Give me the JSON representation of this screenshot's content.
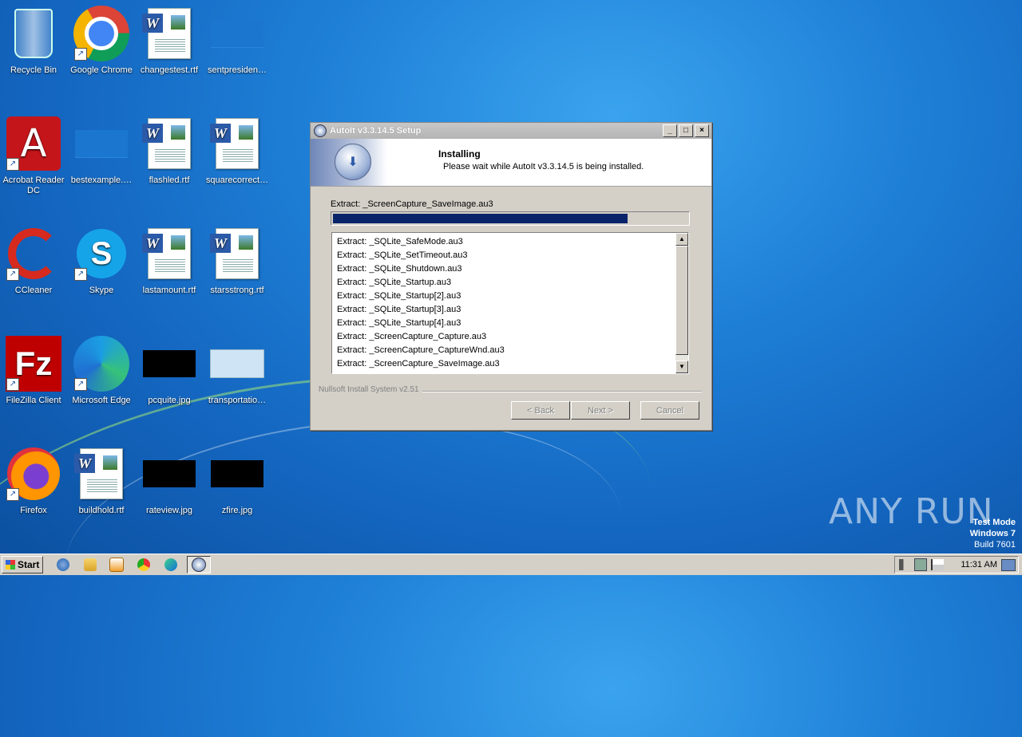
{
  "desktop": {
    "icons": [
      {
        "label": "Recycle Bin",
        "kind": "recycle-bin"
      },
      {
        "label": "Google Chrome",
        "kind": "chrome"
      },
      {
        "label": "changestest.rtf",
        "kind": "word-doc"
      },
      {
        "label": "sentpresiden…",
        "kind": "blank-thumb"
      },
      {
        "label": "Acrobat Reader DC",
        "kind": "acrobat"
      },
      {
        "label": "bestexample.…",
        "kind": "blank-thumb"
      },
      {
        "label": "flashled.rtf",
        "kind": "word-doc"
      },
      {
        "label": "squarecorrect…",
        "kind": "word-doc"
      },
      {
        "label": "CCleaner",
        "kind": "ccleaner"
      },
      {
        "label": "Skype",
        "kind": "skype"
      },
      {
        "label": "lastamount.rtf",
        "kind": "word-doc"
      },
      {
        "label": "starsstrong.rtf",
        "kind": "word-doc"
      },
      {
        "label": "FileZilla Client",
        "kind": "filezilla"
      },
      {
        "label": "Microsoft Edge",
        "kind": "edge"
      },
      {
        "label": "pcquite.jpg",
        "kind": "black-thumb"
      },
      {
        "label": "transportatio…",
        "kind": "white-thumb"
      },
      {
        "label": "Firefox",
        "kind": "firefox"
      },
      {
        "label": "buildhold.rtf",
        "kind": "word-doc"
      },
      {
        "label": "rateview.jpg",
        "kind": "black-thumb"
      },
      {
        "label": "zfire.jpg",
        "kind": "black-thumb"
      }
    ]
  },
  "dialog": {
    "title": "AutoIt v3.3.14.5 Setup",
    "header_title": "Installing",
    "header_subtitle": "Please wait while AutoIt v3.3.14.5 is being installed.",
    "current_action": "Extract: _ScreenCapture_SaveImage.au3",
    "progress": 0.83,
    "log": [
      "Extract: _SQLite_SafeMode.au3",
      "Extract: _SQLite_SetTimeout.au3",
      "Extract: _SQLite_Shutdown.au3",
      "Extract: _SQLite_Startup.au3",
      "Extract: _SQLite_Startup[2].au3",
      "Extract: _SQLite_Startup[3].au3",
      "Extract: _SQLite_Startup[4].au3",
      "Extract: _ScreenCapture_Capture.au3",
      "Extract: _ScreenCapture_CaptureWnd.au3",
      "Extract: _ScreenCapture_SaveImage.au3"
    ],
    "branding": "Nullsoft Install System v2.51",
    "buttons": {
      "back": "< Back",
      "next": "Next >",
      "cancel": "Cancel"
    }
  },
  "taskbar": {
    "start_label": "Start",
    "clock": "11:31 AM",
    "quick_launch": [
      "ie-icon",
      "explorer-icon",
      "media-player-icon",
      "chrome-icon",
      "edge-icon"
    ],
    "active_task_icon": "autoit-setup-icon"
  },
  "watermark": {
    "line1": "Test Mode",
    "line2": "Windows 7",
    "line3": "Build 7601",
    "brand": "ANY RUN"
  }
}
